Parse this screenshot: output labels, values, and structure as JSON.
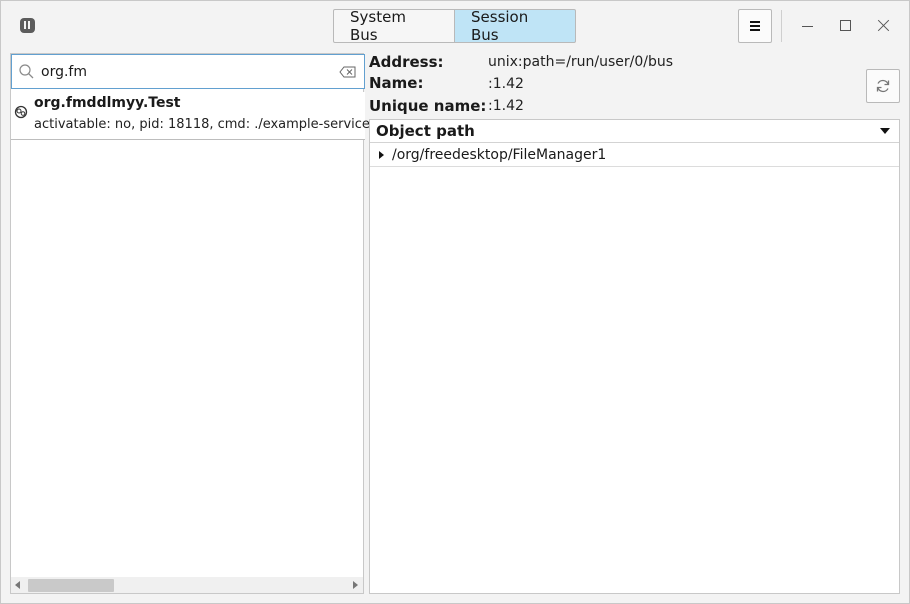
{
  "header": {
    "buses": [
      {
        "label": "System Bus",
        "selected": false
      },
      {
        "label": "Session Bus",
        "selected": true
      }
    ],
    "icons": {
      "app": "app-logo-icon",
      "menu": "hamburger-menu-icon",
      "minimize": "minimize-icon",
      "maximize": "maximize-icon",
      "close": "close-icon"
    }
  },
  "search": {
    "value": "org.fm",
    "icon": "search-icon",
    "clear_icon": "clear-icon"
  },
  "services": [
    {
      "name": "org.fmddlmyy.Test",
      "detail": "activatable: no, pid: 18118, cmd: ./example-service",
      "icon": "service-icon"
    }
  ],
  "info": {
    "address_label": "Address:",
    "address_value": "unix:path=/run/user/0/bus",
    "name_label": "Name:",
    "name_value": ":1.42",
    "unique_label": "Unique name:",
    "unique_value": ":1.42",
    "refresh_icon": "refresh-icon"
  },
  "tree": {
    "header": "Object path",
    "rows": [
      {
        "path": "/org/freedesktop/FileManager1",
        "expanded": false
      }
    ]
  },
  "colors": {
    "accent_selected": "#bfe4f6",
    "focus_border": "#62a0d0"
  }
}
